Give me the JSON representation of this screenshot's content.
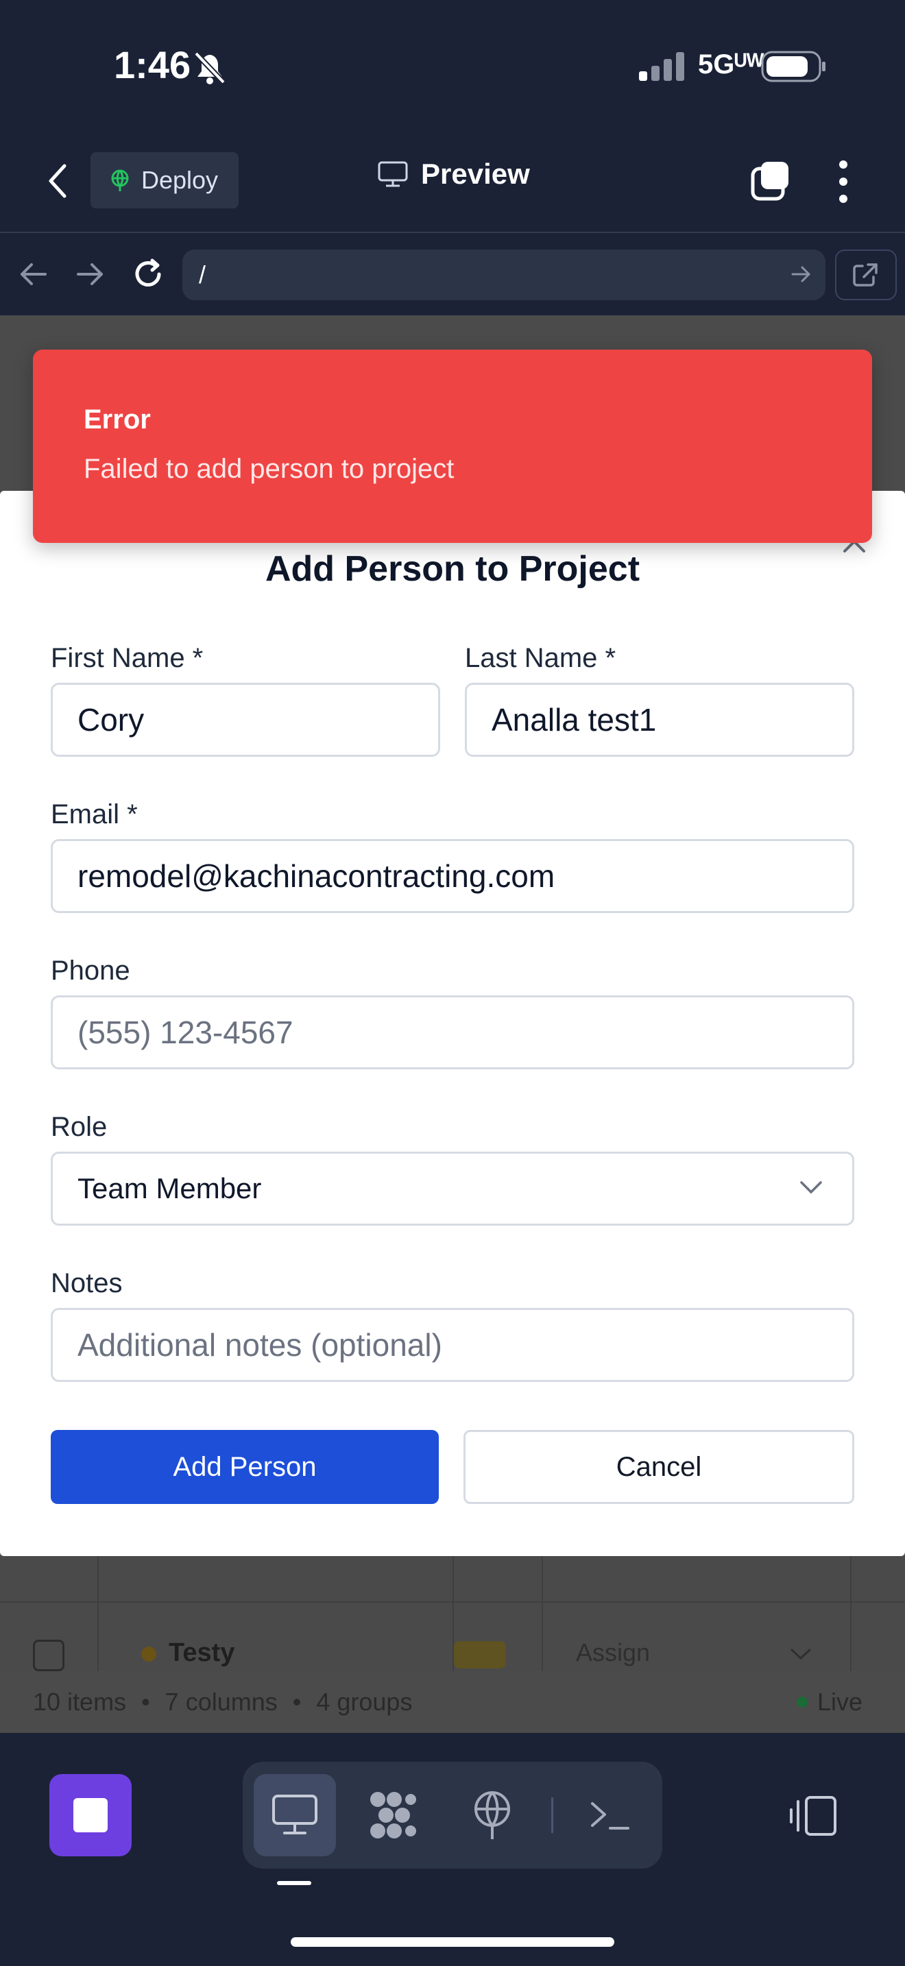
{
  "status_bar": {
    "time": "1:46",
    "network": "5Gᵁᵂ"
  },
  "top_nav": {
    "deploy_label": "Deploy",
    "title": "Preview"
  },
  "url_bar": {
    "value": "/"
  },
  "toast": {
    "title": "Error",
    "message": "Failed to add person to project"
  },
  "dialog": {
    "title": "Add Person to Project",
    "fields": {
      "first_name": {
        "label": "First Name *",
        "value": "Cory"
      },
      "last_name": {
        "label": "Last Name *",
        "value": "Analla test1"
      },
      "email": {
        "label": "Email *",
        "value": "remodel@kachinacontracting.com"
      },
      "phone": {
        "label": "Phone",
        "placeholder": "(555) 123-4567"
      },
      "role": {
        "label": "Role",
        "value": "Team Member"
      },
      "notes": {
        "label": "Notes",
        "placeholder": "Additional notes (optional)"
      }
    },
    "add_button": "Add Person",
    "cancel_button": "Cancel"
  },
  "background_table": {
    "row_name": "Testy",
    "row_assign": "Assign",
    "footer": {
      "items": "10 items",
      "sep": "•",
      "columns": "7 columns",
      "groups": "4 groups",
      "live": "Live"
    }
  },
  "colors": {
    "accent": "#1d4fd8",
    "error": "#ef4444",
    "brand_purple": "#6d3fe0",
    "chrome": "#1b2236"
  }
}
